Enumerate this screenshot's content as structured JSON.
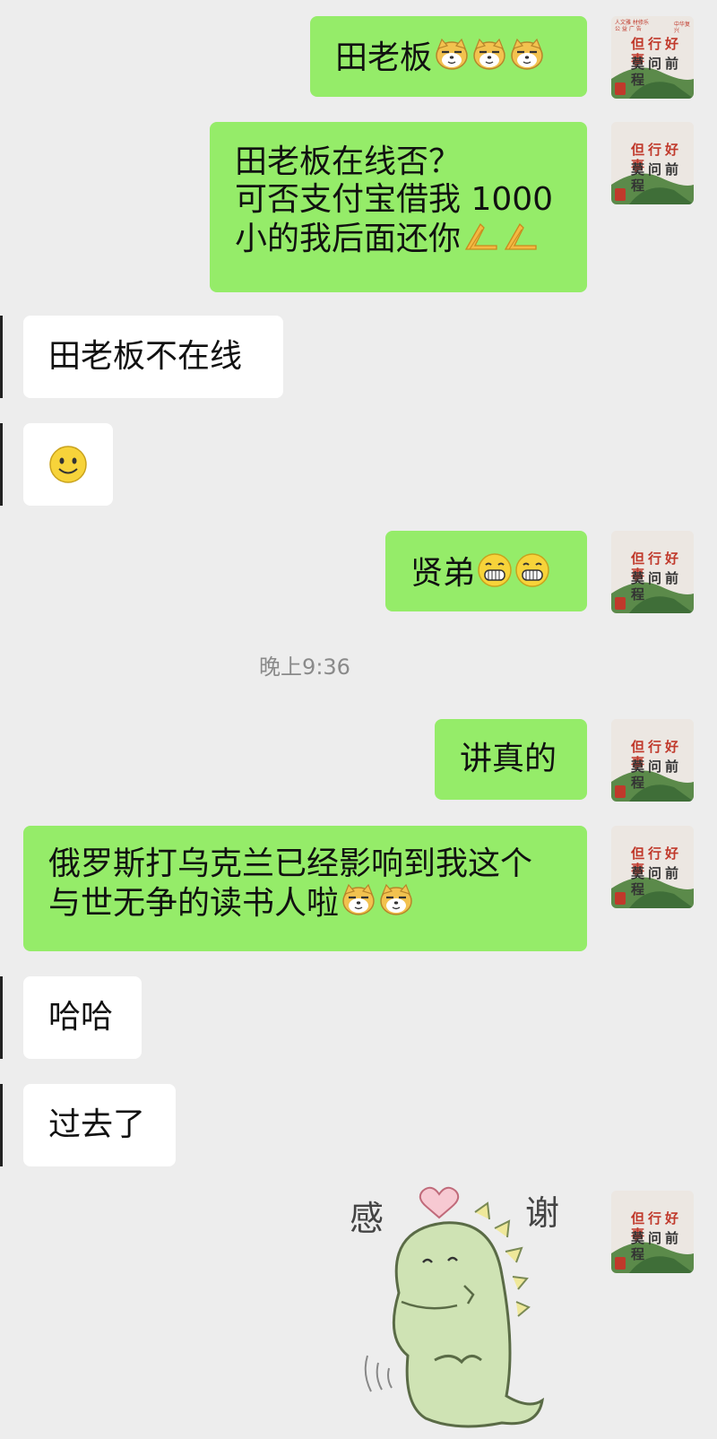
{
  "conversation": {
    "timestamp": "晚上9:36",
    "messages": [
      {
        "id": "m1",
        "side": "right",
        "text": "田老板",
        "emoji": [
          "doge-icon",
          "doge-icon",
          "doge-icon"
        ]
      },
      {
        "id": "m2",
        "side": "right",
        "lines": [
          "田老板在线否？",
          "可否支付宝借我 1000",
          "小的我后面还你"
        ],
        "emoji": [
          "pray-icon",
          "pray-icon"
        ]
      },
      {
        "id": "m3",
        "side": "left",
        "text": "田老板不在线"
      },
      {
        "id": "m4",
        "side": "left",
        "emoji": [
          "smile-icon"
        ]
      },
      {
        "id": "m5",
        "side": "right",
        "text": "贤弟",
        "emoji": [
          "grin-icon",
          "grin-icon"
        ]
      },
      {
        "id": "m6",
        "side": "right",
        "text": "讲真的"
      },
      {
        "id": "m7",
        "side": "right",
        "lines": [
          "俄罗斯打乌克兰已经影响到我这个",
          "与世无争的读书人啦"
        ],
        "emoji": [
          "doge-icon",
          "doge-icon"
        ]
      },
      {
        "id": "m8",
        "side": "left",
        "text": "哈哈"
      },
      {
        "id": "m9",
        "side": "left",
        "text": "过去了"
      },
      {
        "id": "m10",
        "side": "right",
        "sticker": "dinosaur-thanks-sticker",
        "sticker_text": [
          "感",
          "谢"
        ]
      }
    ]
  },
  "avatar": {
    "line1": "但行好事",
    "line2": "莫问前程",
    "tiny_left": "人文雅 材修乐",
    "tiny_left2": "公 益 广 告",
    "tiny_right": "中华复兴"
  },
  "colors": {
    "background": "#ededed",
    "self_bubble": "#95ec69",
    "other_bubble": "#ffffff",
    "timestamp": "#8a8a8a"
  }
}
